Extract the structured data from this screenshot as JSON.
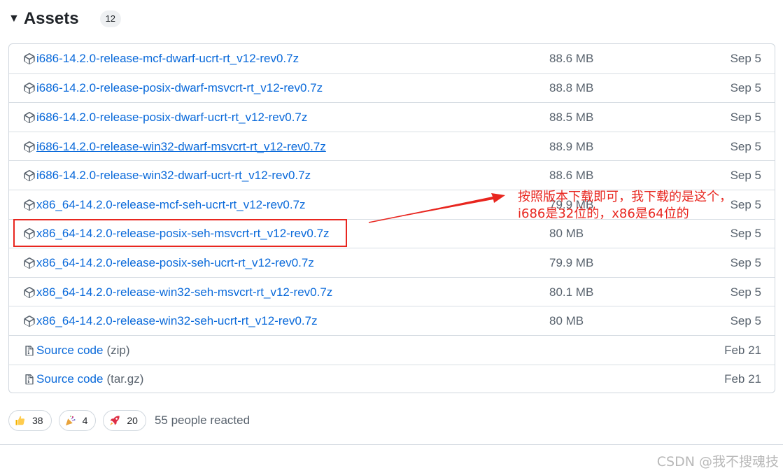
{
  "assets": {
    "title": "Assets",
    "count": "12",
    "items": [
      {
        "name": "i686-14.2.0-release-mcf-dwarf-ucrt-rt_v12-rev0.7z",
        "size": "88.6 MB",
        "date": "Sep 5"
      },
      {
        "name": "i686-14.2.0-release-posix-dwarf-msvcrt-rt_v12-rev0.7z",
        "size": "88.8 MB",
        "date": "Sep 5"
      },
      {
        "name": "i686-14.2.0-release-posix-dwarf-ucrt-rt_v12-rev0.7z",
        "size": "88.5 MB",
        "date": "Sep 5"
      },
      {
        "name": "i686-14.2.0-release-win32-dwarf-msvcrt-rt_v12-rev0.7z",
        "size": "88.9 MB",
        "date": "Sep 5"
      },
      {
        "name": "i686-14.2.0-release-win32-dwarf-ucrt-rt_v12-rev0.7z",
        "size": "88.6 MB",
        "date": "Sep 5"
      },
      {
        "name": "x86_64-14.2.0-release-mcf-seh-ucrt-rt_v12-rev0.7z",
        "size": "79.9 MB",
        "date": "Sep 5"
      },
      {
        "name": "x86_64-14.2.0-release-posix-seh-msvcrt-rt_v12-rev0.7z",
        "size": "80 MB",
        "date": "Sep 5"
      },
      {
        "name": "x86_64-14.2.0-release-posix-seh-ucrt-rt_v12-rev0.7z",
        "size": "79.9 MB",
        "date": "Sep 5"
      },
      {
        "name": "x86_64-14.2.0-release-win32-seh-msvcrt-rt_v12-rev0.7z",
        "size": "80.1 MB",
        "date": "Sep 5"
      },
      {
        "name": "x86_64-14.2.0-release-win32-seh-ucrt-rt_v12-rev0.7z",
        "size": "80 MB",
        "date": "Sep 5"
      }
    ],
    "source": [
      {
        "label": "Source code",
        "ext": "(zip)",
        "date": "Feb 21"
      },
      {
        "label": "Source code",
        "ext": "(tar.gz)",
        "date": "Feb 21"
      }
    ]
  },
  "annotation": {
    "line1": "按照版本下载即可，我下载的是这个，",
    "line2": "i686是32位的，x86是64位的",
    "color": "#e8261f"
  },
  "reactions": {
    "items": [
      {
        "icon": "thumbs-up-icon",
        "count": "38"
      },
      {
        "icon": "party-popper-icon",
        "count": "4"
      },
      {
        "icon": "rocket-icon",
        "count": "20"
      }
    ],
    "summary": "55 people reacted"
  },
  "watermark": "CSDN @我不搜魂技",
  "colors": {
    "link": "#0969da",
    "muted": "#59636e",
    "border": "#d0d7de",
    "highlight": "#e8261f"
  }
}
